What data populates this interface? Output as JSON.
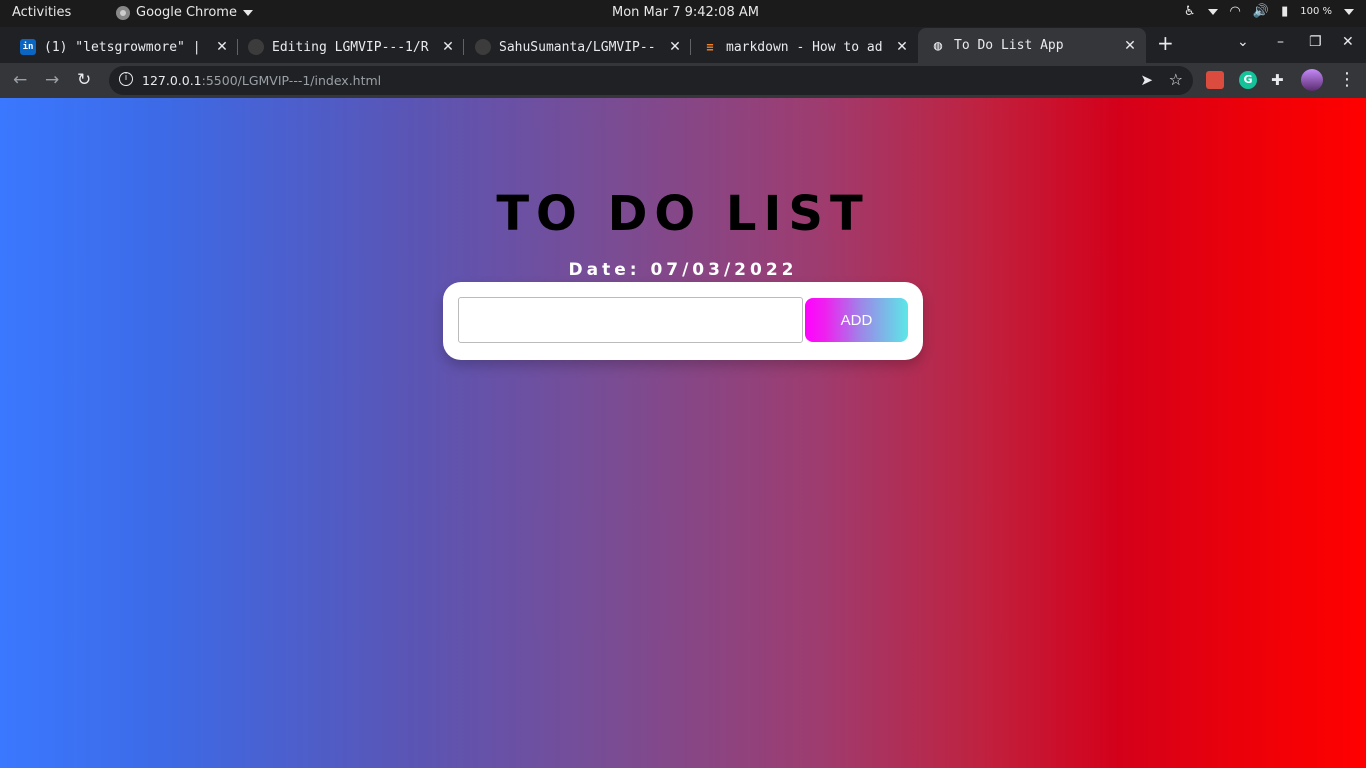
{
  "system_bar": {
    "activities": "Activities",
    "app_name": "Google Chrome",
    "clock": "Mon Mar 7  9:42:08 AM",
    "battery": "100 %"
  },
  "tabs": [
    {
      "title": "(1) \"letsgrowmore\" |",
      "icon": "linkedin-icon"
    },
    {
      "title": "Editing LGMVIP---1/R",
      "icon": "github-icon"
    },
    {
      "title": "SahuSumanta/LGMVIP--",
      "icon": "github-icon"
    },
    {
      "title": "markdown - How to ad",
      "icon": "stackoverflow-icon"
    },
    {
      "title": "To Do List App",
      "icon": "globe-icon",
      "active": true
    }
  ],
  "address_bar": {
    "host": "127.0.0.1",
    "path": ":5500/LGMVIP---1/index.html"
  },
  "app": {
    "title": "TO DO LIST",
    "date": "Date: 07/03/2022",
    "input_value": "",
    "add_label": "ADD"
  },
  "colors": {
    "gradient_left": "#3a78ff",
    "gradient_right": "#ff0000",
    "button_start": "#ff00ff",
    "button_end": "#5ce7e7"
  }
}
